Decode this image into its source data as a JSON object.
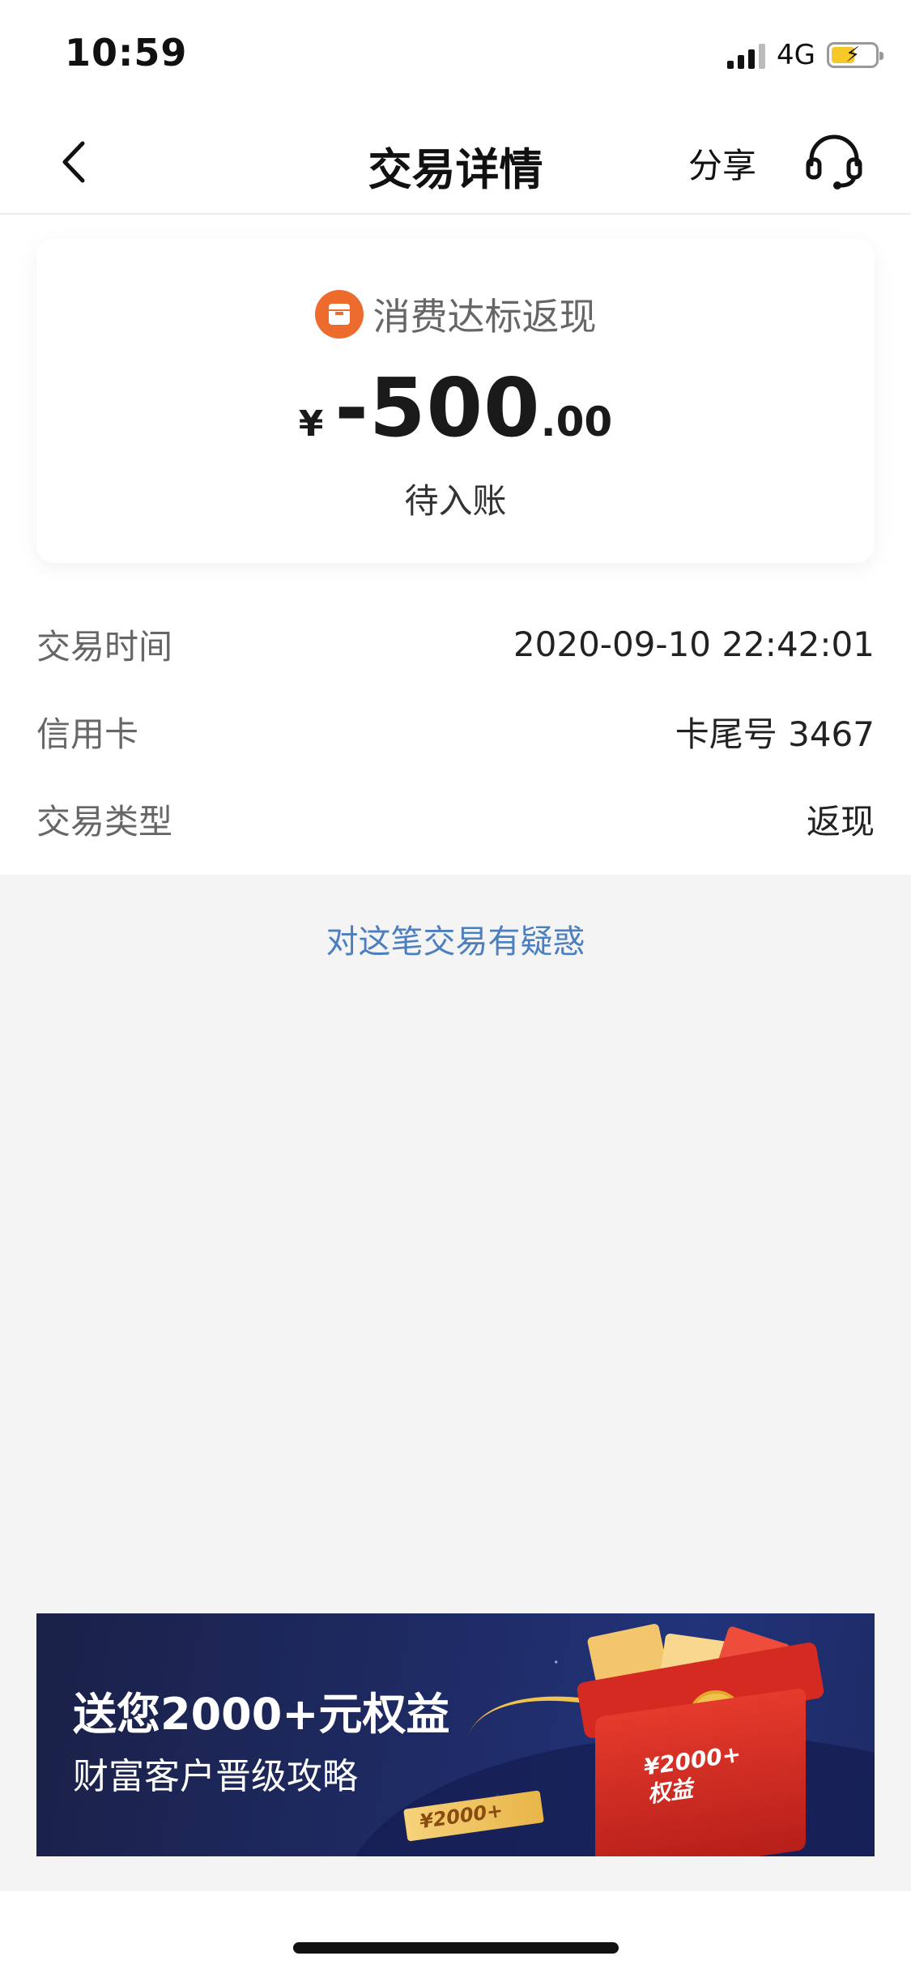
{
  "status_bar": {
    "time": "10:59",
    "network": "4G",
    "battery_color": "#f6c829"
  },
  "nav": {
    "title": "交易详情",
    "share_label": "分享",
    "back_icon": "chevron-left",
    "service_icon": "headset"
  },
  "card": {
    "type_label": "消费达标返现",
    "type_icon": "cashback-box",
    "icon_color": "#ec6b2d",
    "currency": "¥",
    "amount_int": "-500",
    "amount_dec": ".00",
    "status": "待入账"
  },
  "details": [
    {
      "label": "交易时间",
      "value": "2020-09-10 22:42:01"
    },
    {
      "label": "信用卡",
      "value": "卡尾号 3467"
    },
    {
      "label": "交易类型",
      "value": "返现"
    }
  ],
  "question_link": "对这笔交易有疑惑",
  "link_color": "#4b7fc0",
  "banner": {
    "title": "送您2000+元权益",
    "subtitle": "财富客户晋级攻略",
    "gift_line1": "¥2000+",
    "gift_line2": "权益",
    "ticket": "¥2000+"
  }
}
